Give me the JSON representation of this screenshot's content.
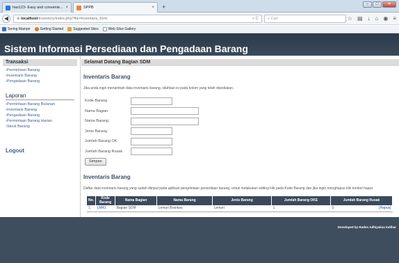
{
  "browser": {
    "tabs": [
      {
        "title": "has123- Easy and convenie...",
        "close": "×"
      },
      {
        "title": "SPPB",
        "close": "×"
      }
    ],
    "new_tab": "+",
    "url_host": "localhost",
    "url_path": "/inventory/index.php?file=inventaris_form",
    "search_placeholder": "Cari",
    "bookmarks": [
      "Sering Mampir",
      "Getting Started",
      "Suggested Sites",
      "Web Slice Gallery"
    ],
    "window_buttons": [
      "–",
      "□",
      "✕"
    ]
  },
  "site": {
    "title": "Sistem Informasi Persediaan dan Pengadaan Barang",
    "footer": "Developed by Raden Adhiyaksa Indihar"
  },
  "sidebar": {
    "transaksi_title": "Transaksi",
    "transaksi_items": [
      "›Permintaan Barang",
      "›Inventaris Barang",
      "›Pengadaan Barang"
    ],
    "laporan_title": "Laporan",
    "laporan_items": [
      "›Permintaan Barang Bulanan",
      "›Inventaris Barang",
      "›Pengadaan Barang",
      "›Permintaan Barang Harian",
      "›Stock Barang"
    ],
    "logout": "Logout"
  },
  "main": {
    "welcome": "Selamat Datang Bagian SDM",
    "form_title": "Inventaris Barang",
    "form_desc": "Jika anda ingin menambah data inventaris barang, silahkan isi pada kolom yang telah disediakan.",
    "fields": [
      {
        "label": "Kode Barang",
        "value": ""
      },
      {
        "label": "Nama Bagian",
        "value": ""
      },
      {
        "label": "Nama Barang",
        "value": ""
      },
      {
        "label": "Jenis Barang",
        "value": ""
      },
      {
        "label": "Jumlah Barang OK",
        "value": ""
      },
      {
        "label": "Jumlah Barang Rusak",
        "value": ""
      }
    ],
    "submit_label": "Simpan",
    "list_title": "Inventaris Barang",
    "list_desc": "Daftar data inventaris barang yang sudah diinput pada aplikasi pengelolaan persediaan barang, untuk melakukan editing klik pada Kode Barang dan jika ingin menghapus klik tombol hapus",
    "table": {
      "headers": [
        "No.",
        "Kode Barang",
        "Nama Bagian",
        "Nama Barang",
        "Jenis Barang",
        "Jumlah Barang OKE",
        "Jumlah Barang Rusak"
      ],
      "rows": [
        {
          "no": "1.",
          "kode": "LMR1",
          "bagian": "Bagian SDM",
          "barang": "Lemari Brankas",
          "jenis": "Lemari",
          "ok": "1",
          "rusak": "0",
          "action": "[Hapus]"
        }
      ]
    }
  }
}
